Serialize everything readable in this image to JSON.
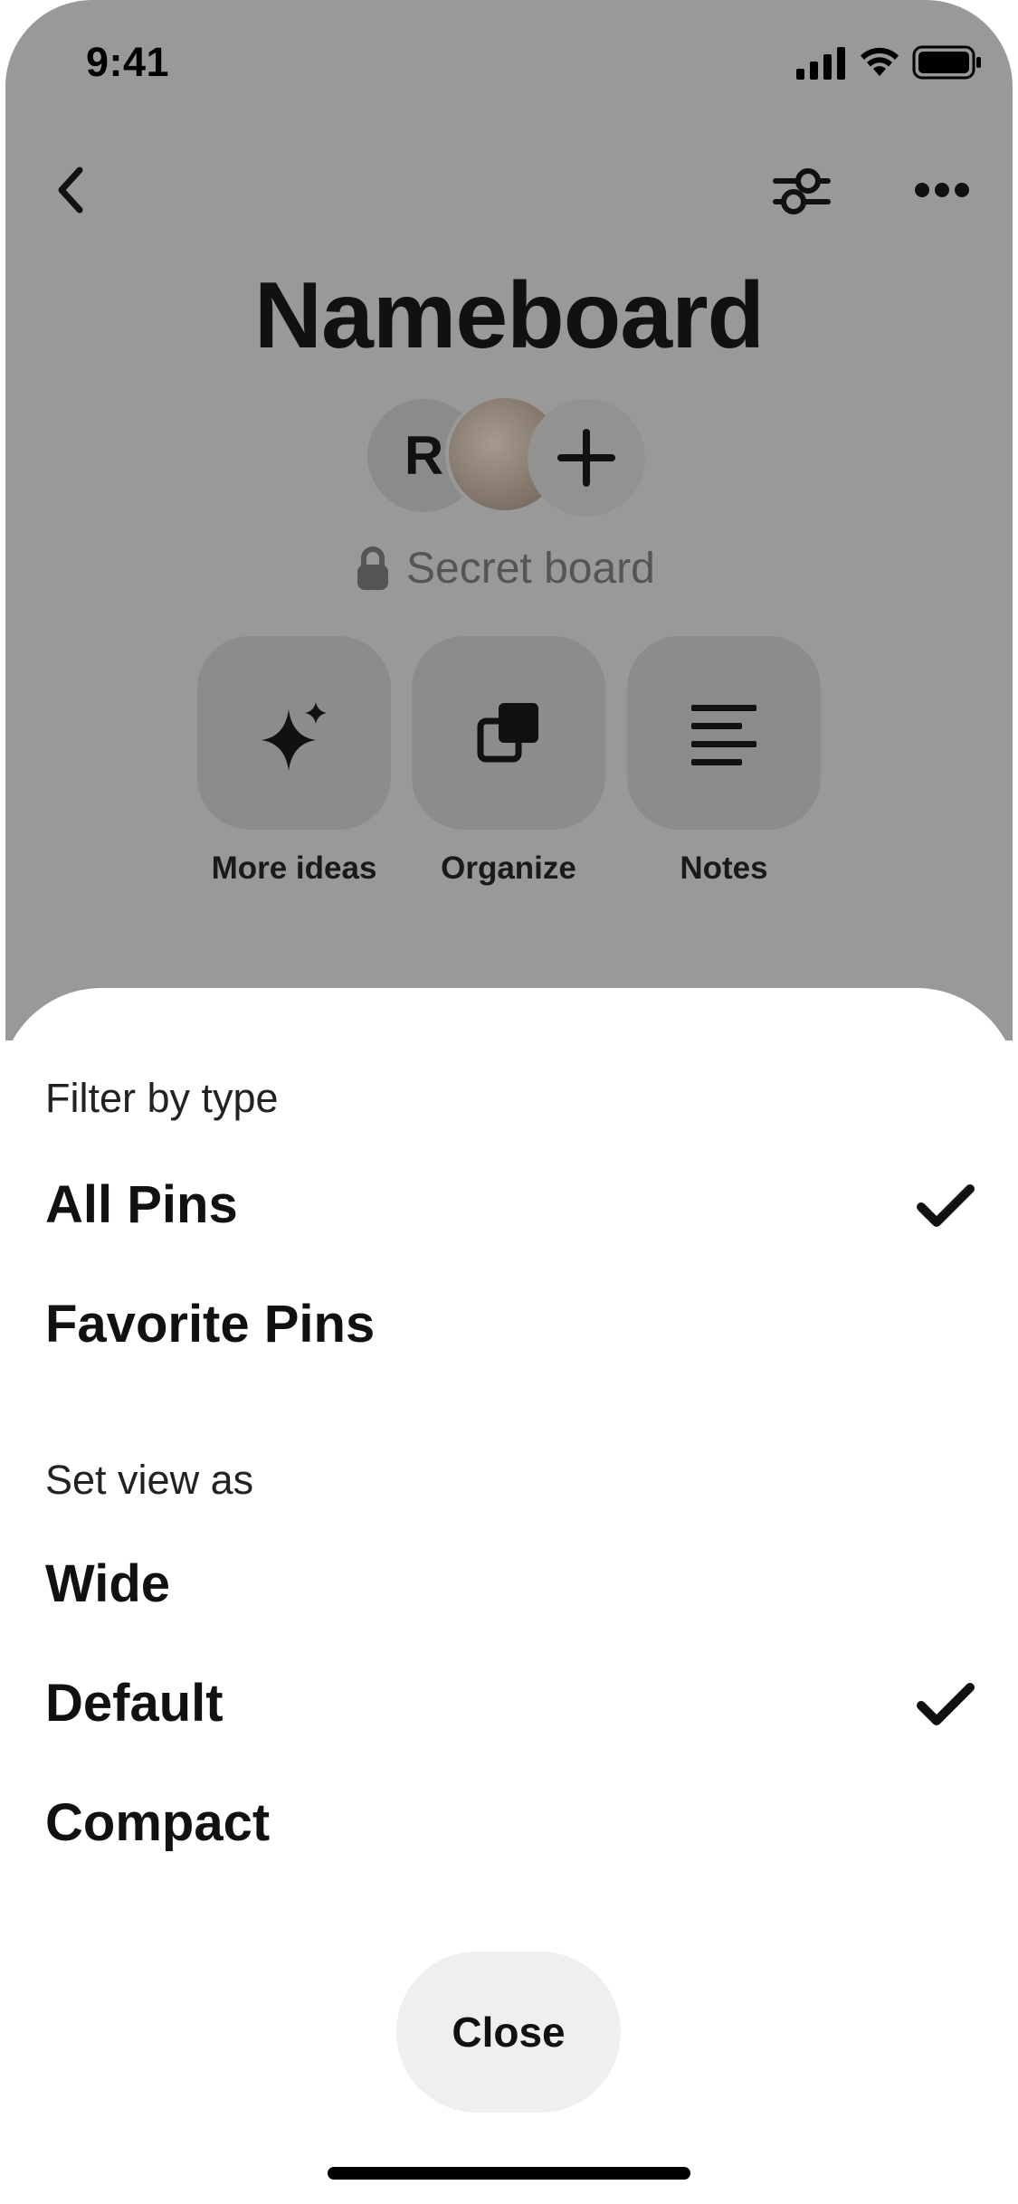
{
  "status_bar": {
    "time": "9:41"
  },
  "board": {
    "title": "Nameboard",
    "collaborator_initial": "R",
    "privacy_label": "Secret board",
    "actions": [
      {
        "label": "More ideas",
        "icon": "sparkle-icon"
      },
      {
        "label": "Organize",
        "icon": "organize-icon"
      },
      {
        "label": "Notes",
        "icon": "notes-icon"
      }
    ]
  },
  "sheet": {
    "filter_heading": "Filter by type",
    "filter_options": [
      {
        "label": "All Pins",
        "selected": true
      },
      {
        "label": "Favorite Pins",
        "selected": false
      }
    ],
    "view_heading": "Set view as",
    "view_options": [
      {
        "label": "Wide",
        "selected": false
      },
      {
        "label": "Default",
        "selected": true
      },
      {
        "label": "Compact",
        "selected": false
      }
    ],
    "close_label": "Close"
  },
  "colors": {
    "scrim": "#999999",
    "sheet_background": "#ffffff",
    "close_button": "#efefef",
    "text_primary": "#111111"
  }
}
